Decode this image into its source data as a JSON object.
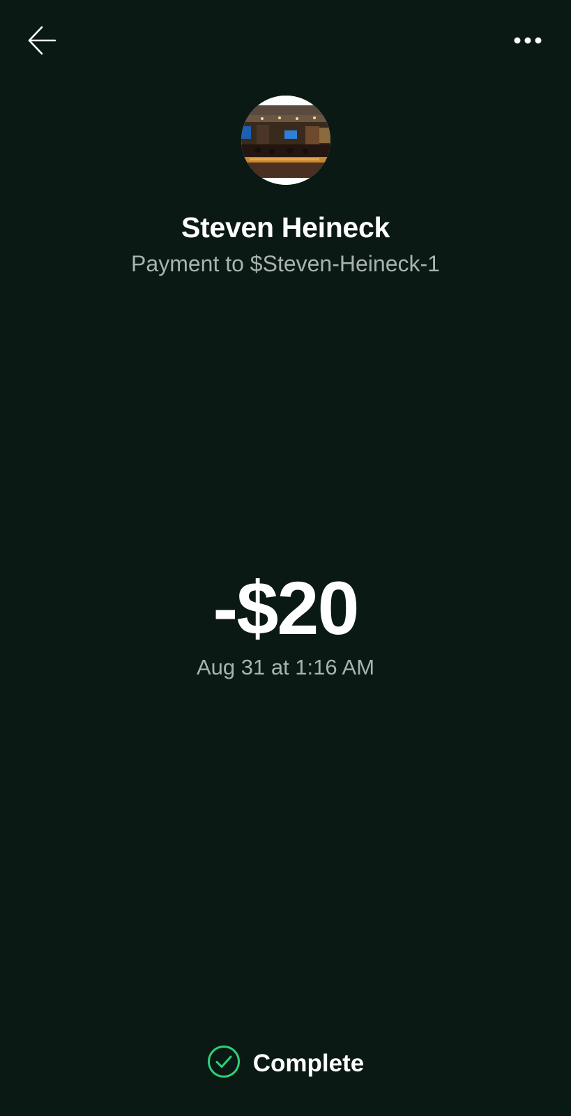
{
  "header": {
    "back_icon": "arrow-left-icon",
    "menu_icon": "more-horizontal-icon"
  },
  "recipient": {
    "name": "Steven Heineck",
    "subtitle": "Payment to $Steven-Heineck-1",
    "avatar": "restaurant-bar-photo"
  },
  "transaction": {
    "amount": "-$20",
    "datetime": "Aug 31 at 1:16 AM"
  },
  "status": {
    "label": "Complete",
    "icon": "check-circle-icon",
    "color": "#2fcf7a"
  },
  "colors": {
    "background": "#0b1914",
    "primary_text": "#ffffff",
    "secondary_text": "#a9b3ae",
    "success": "#2fcf7a"
  }
}
